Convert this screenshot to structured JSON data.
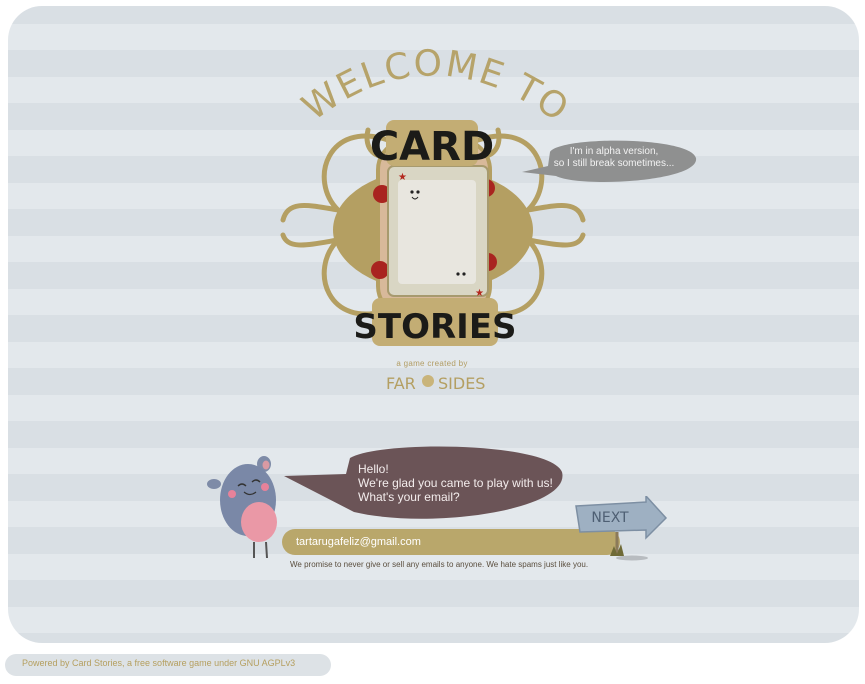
{
  "header": {
    "welcome_text": "WELCOME TO",
    "logo_word_top": "CARD",
    "logo_word_bottom": "STORIES"
  },
  "alpha_bubble": {
    "line1": "I'm in alpha version,",
    "line2": "so I still break sometimes..."
  },
  "credits": {
    "created_by": "a game created by",
    "studio_left": "FAR",
    "studio_right": "SIDES"
  },
  "greeting": {
    "line1": "Hello!",
    "line2": "We're glad you came to play with us!",
    "line3": "What's your email?"
  },
  "email_form": {
    "value": "tartarugafeliz@gmail.com",
    "next_label": "NEXT",
    "promise": "We promise to never give or sell any emails to anyone. We hate spams just like you."
  },
  "footer": {
    "text": "Powered by Card Stories, a free software game under GNU AGPLv3"
  },
  "colors": {
    "gold": "#b9a76b",
    "dark_bubble": "#6b5457",
    "grey_bubble": "#8f9090",
    "stripe_light": "#e3e8ec",
    "stripe_dark": "#d9dfe4"
  }
}
